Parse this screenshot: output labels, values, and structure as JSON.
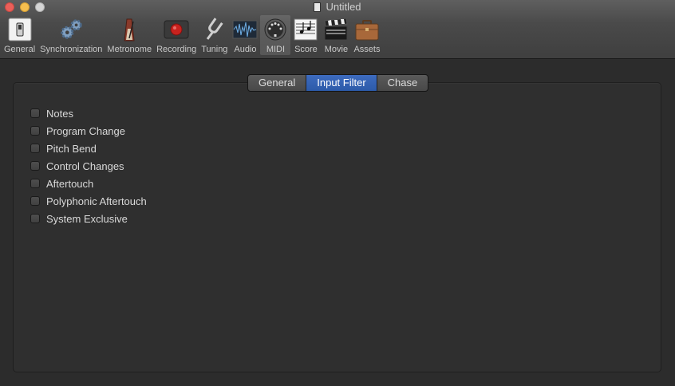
{
  "window": {
    "title": "Untitled"
  },
  "toolbar": {
    "items": [
      {
        "label": "General",
        "icon": "switch-icon"
      },
      {
        "label": "Synchronization",
        "icon": "gears-icon"
      },
      {
        "label": "Metronome",
        "icon": "metronome-icon"
      },
      {
        "label": "Recording",
        "icon": "record-icon"
      },
      {
        "label": "Tuning",
        "icon": "tuning-fork-icon"
      },
      {
        "label": "Audio",
        "icon": "waveform-icon"
      },
      {
        "label": "MIDI",
        "icon": "midi-connector-icon",
        "selected": true
      },
      {
        "label": "Score",
        "icon": "sheet-music-icon"
      },
      {
        "label": "Movie",
        "icon": "clapperboard-icon"
      },
      {
        "label": "Assets",
        "icon": "briefcase-icon"
      }
    ]
  },
  "tabs": [
    {
      "label": "General",
      "active": false
    },
    {
      "label": "Input Filter",
      "active": true
    },
    {
      "label": "Chase",
      "active": false
    }
  ],
  "filters": [
    {
      "label": "Notes",
      "checked": false
    },
    {
      "label": "Program Change",
      "checked": false
    },
    {
      "label": "Pitch Bend",
      "checked": false
    },
    {
      "label": "Control Changes",
      "checked": false
    },
    {
      "label": "Aftertouch",
      "checked": false
    },
    {
      "label": "Polyphonic Aftertouch",
      "checked": false
    },
    {
      "label": "System Exclusive",
      "checked": false
    }
  ],
  "colors": {
    "accent": "#2c5aa8",
    "background": "#2c2c2c",
    "record_red": "#c8221e"
  }
}
